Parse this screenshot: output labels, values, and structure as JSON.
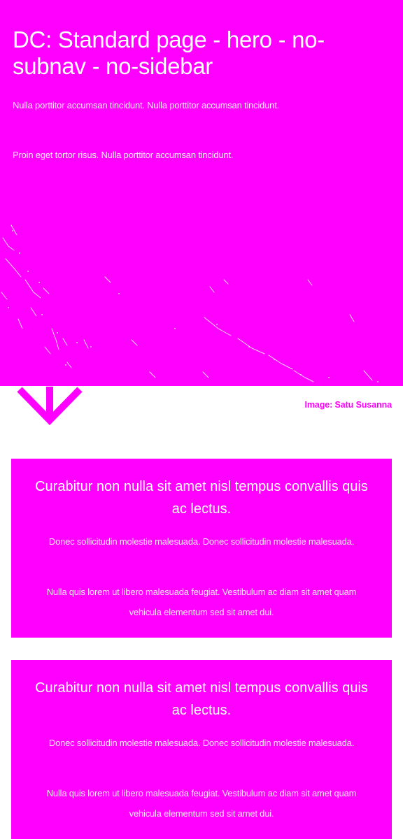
{
  "hero": {
    "title": "DC: Standard page - hero - no-subnav - no-sidebar",
    "paragraphs": [
      "Nulla porttitor accumsan tincidunt. Nulla porttitor accumsan tincidunt.",
      "Proin eget tortor risus. Nulla porttitor accumsan tincidunt."
    ],
    "background_color": "#ff00ff"
  },
  "scroll_indicator": {
    "icon": "chevron-down-icon"
  },
  "image_credit": "Image: Satu Susanna",
  "cards": [
    {
      "title": "Curabitur non nulla sit amet nisl tempus convallis quis ac lectus.",
      "paragraphs": [
        "Donec sollicitudin molestie malesuada. Donec sollicitudin molestie malesuada.",
        "Nulla quis lorem ut libero malesuada feugiat. Vestibulum ac diam sit amet quam vehicula elementum sed sit amet dui."
      ]
    },
    {
      "title": "Curabitur non nulla sit amet nisl tempus convallis quis ac lectus.",
      "paragraphs": [
        "Donec sollicitudin molestie malesuada. Donec sollicitudin molestie malesuada.",
        "Nulla quis lorem ut libero malesuada feugiat. Vestibulum ac diam sit amet quam vehicula elementum sed sit amet dui."
      ]
    }
  ],
  "colors": {
    "accent": "#ff00ff",
    "text_on_accent": "#ffffff",
    "page_background": "#ffffff"
  }
}
